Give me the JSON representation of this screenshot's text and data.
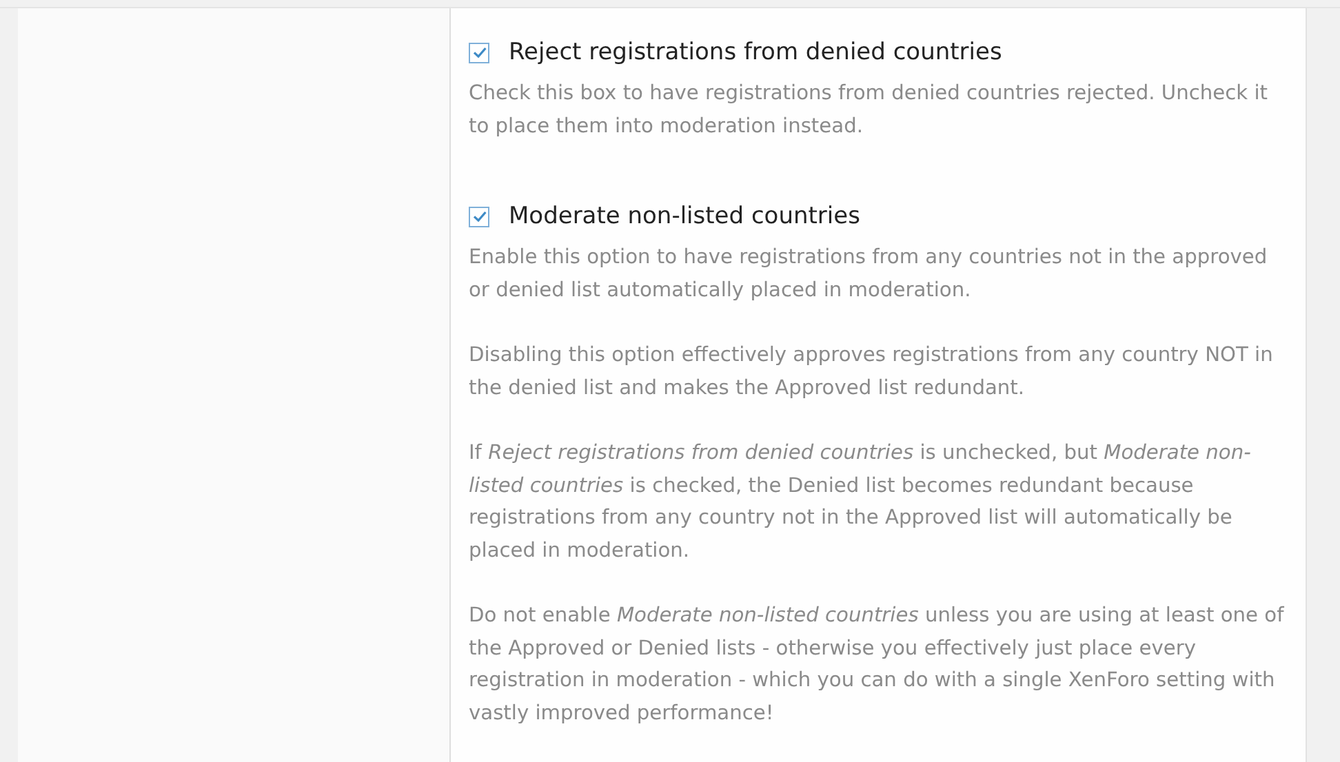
{
  "options": [
    {
      "label": "Reject registrations from denied countries",
      "checked": true,
      "description": [
        "Check this box to have registrations from denied countries rejected. Uncheck it to place them into moderation instead."
      ]
    },
    {
      "label": "Moderate non-listed countries",
      "checked": true,
      "description": [
        "Enable this option to have registrations from any countries not in the approved or denied list automatically placed in moderation.",
        "Disabling this option effectively approves registrations from any country NOT in the denied list and makes the Approved list redundant.",
        "If *Reject registrations from denied countries* is unchecked, but *Moderate non-listed countries* is checked, the Denied list becomes redundant because registrations from any country not in the Approved list will automatically be placed in moderation.",
        "Do not enable *Moderate non-listed countries* unless you are using at least one of the Approved or Denied lists - otherwise you effectively just place every registration in moderation - which you can do with a single XenForo setting with vastly improved performance!"
      ]
    }
  ]
}
